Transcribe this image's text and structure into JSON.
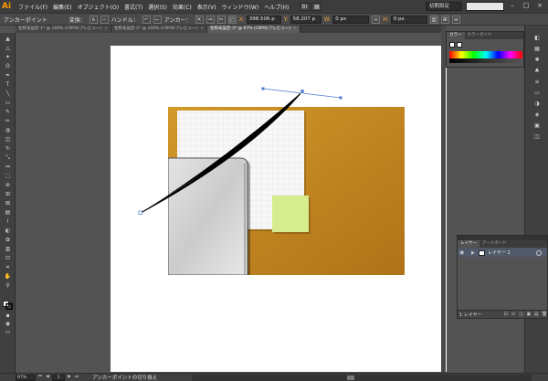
{
  "app": {
    "logo": "Ai",
    "menu": [
      "ファイル(F)",
      "編集(E)",
      "オブジェクト(O)",
      "書式(T)",
      "選択(S)",
      "効果(C)",
      "表示(V)",
      "ウィンドウ(W)",
      "ヘルプ(H)"
    ],
    "workspace": "初期設定",
    "window_controls": [
      "–",
      "□",
      "×"
    ]
  },
  "control_bar": {
    "mode_label": "アンカーポイント",
    "convert_label": "変換：",
    "handle_label": "ハンドル：",
    "anchor_label": "アンカー：",
    "x_label": "X:",
    "x_value": "398.506 p",
    "y_label": "Y:",
    "y_value": "58.207 p",
    "w_label": "W:",
    "w_value": "0 px",
    "h_label": "H:",
    "h_value": "0 px"
  },
  "tabs": [
    {
      "label": "名称未設定-1* @ 100% (CMYK/プレビュー)",
      "active": false
    },
    {
      "label": "名称未設定-2* @ 100% (CMYK/プレビュー)",
      "active": false
    },
    {
      "label": "名称未設定-3* @ 67% (CMYK/プレビュー)",
      "active": true
    }
  ],
  "tab_close": "×",
  "tools": [
    {
      "icon": "selection-icon",
      "glyph": "▲"
    },
    {
      "icon": "direct-selection-icon",
      "glyph": "△"
    },
    {
      "icon": "magic-wand-icon",
      "glyph": "✦"
    },
    {
      "icon": "lasso-icon",
      "glyph": "ʘ"
    },
    {
      "icon": "pen-icon",
      "glyph": "✒"
    },
    {
      "icon": "type-icon",
      "glyph": "T"
    },
    {
      "icon": "line-icon",
      "glyph": "╲"
    },
    {
      "icon": "rectangle-icon",
      "glyph": "▭"
    },
    {
      "icon": "brush-icon",
      "glyph": "✎"
    },
    {
      "icon": "pencil-icon",
      "glyph": "✏"
    },
    {
      "icon": "blob-brush-icon",
      "glyph": "◍"
    },
    {
      "icon": "eraser-icon",
      "glyph": "◫"
    },
    {
      "icon": "rotate-icon",
      "glyph": "↻"
    },
    {
      "icon": "scale-icon",
      "glyph": "⤡"
    },
    {
      "icon": "width-icon",
      "glyph": "⇔"
    },
    {
      "icon": "free-transform-icon",
      "glyph": "⬚"
    },
    {
      "icon": "shape-builder-icon",
      "glyph": "⊕"
    },
    {
      "icon": "perspective-icon",
      "glyph": "⊞"
    },
    {
      "icon": "mesh-icon",
      "glyph": "⊠"
    },
    {
      "icon": "gradient-icon",
      "glyph": "▤"
    },
    {
      "icon": "eyedropper-icon",
      "glyph": "⌇"
    },
    {
      "icon": "blend-icon",
      "glyph": "◐"
    },
    {
      "icon": "symbol-sprayer-icon",
      "glyph": "✿"
    },
    {
      "icon": "graph-icon",
      "glyph": "▥"
    },
    {
      "icon": "artboard-icon",
      "glyph": "⊡"
    },
    {
      "icon": "slice-icon",
      "glyph": "⌗"
    },
    {
      "icon": "hand-icon",
      "glyph": "✋"
    },
    {
      "icon": "zoom-icon",
      "glyph": "⚲"
    }
  ],
  "color_panel": {
    "tabs": [
      "カラー",
      "カラーガイド"
    ]
  },
  "dock_icons": [
    {
      "icon": "color-panel-icon",
      "glyph": "◧"
    },
    {
      "icon": "swatches-icon",
      "glyph": "▦"
    },
    {
      "icon": "brushes-icon",
      "glyph": "✺"
    },
    {
      "icon": "symbols-icon",
      "glyph": "♣"
    },
    {
      "icon": "stroke-icon",
      "glyph": "≡"
    },
    {
      "icon": "gradient-panel-icon",
      "glyph": "▭"
    },
    {
      "icon": "transparency-icon",
      "glyph": "◑"
    },
    {
      "icon": "appearance-icon",
      "glyph": "◈"
    },
    {
      "icon": "graphic-styles-icon",
      "glyph": "▣"
    },
    {
      "icon": "layers-panel-icon",
      "glyph": "◫"
    }
  ],
  "layers_panel": {
    "tabs": [
      "レイヤー",
      "アートボード"
    ],
    "layer_name": "レイヤー 1",
    "layer_count": "1 レイヤー",
    "footer_icons": [
      "⊡",
      "⊙",
      "◫",
      "▣",
      "▤",
      "🗑"
    ]
  },
  "status_bar": {
    "zoom": "67%",
    "page": "1",
    "status": "アンカーポイントの切り換え"
  },
  "colors": {
    "desk": "#d49a2a",
    "desk_dark": "#b07418",
    "note": "#d6ec8e",
    "paper": "#f7f7f7",
    "grid": "#d2dbe6",
    "laptop": "#d0d0d0",
    "path": "#000000",
    "accent": "#ff9a00"
  }
}
